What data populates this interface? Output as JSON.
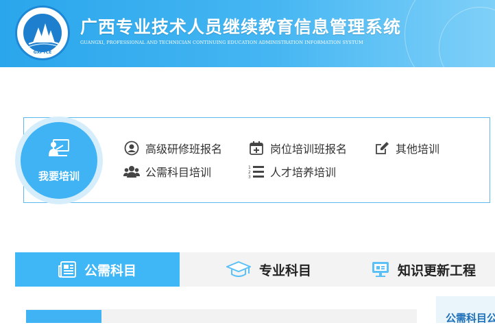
{
  "header": {
    "title": "广西专业技术人员继续教育信息管理系统",
    "subtitle": "GUANGXI, PROFESSIONAL AND TECHNICIAN CONTINUING EDUCATION ADMINISTRATION INFORMATION SYSTUM",
    "logo_text": "GXPTCE"
  },
  "training": {
    "badge_label": "我要培训",
    "links": [
      {
        "label": "高级研修班报名",
        "icon": "user-circle-icon"
      },
      {
        "label": "岗位培训班报名",
        "icon": "calendar-plus-icon"
      },
      {
        "label": "其他培训",
        "icon": "edit-icon"
      },
      {
        "label": "公需科目培训",
        "icon": "users-icon"
      },
      {
        "label": "人才培养培训",
        "icon": "numbered-list-icon"
      }
    ]
  },
  "tabs": [
    {
      "label": "公需科目",
      "icon": "newspaper-icon",
      "active": true
    },
    {
      "label": "专业科目",
      "icon": "graduation-cap-icon",
      "active": false
    },
    {
      "label": "知识更新工程",
      "icon": "monitor-icon",
      "active": false
    }
  ],
  "side_panel": {
    "title": "公需科目公"
  },
  "colors": {
    "primary": "#3fb3f4",
    "header_start": "#2aa6ec",
    "header_end": "#7fd0f8",
    "side_title": "#1d6fb8"
  }
}
